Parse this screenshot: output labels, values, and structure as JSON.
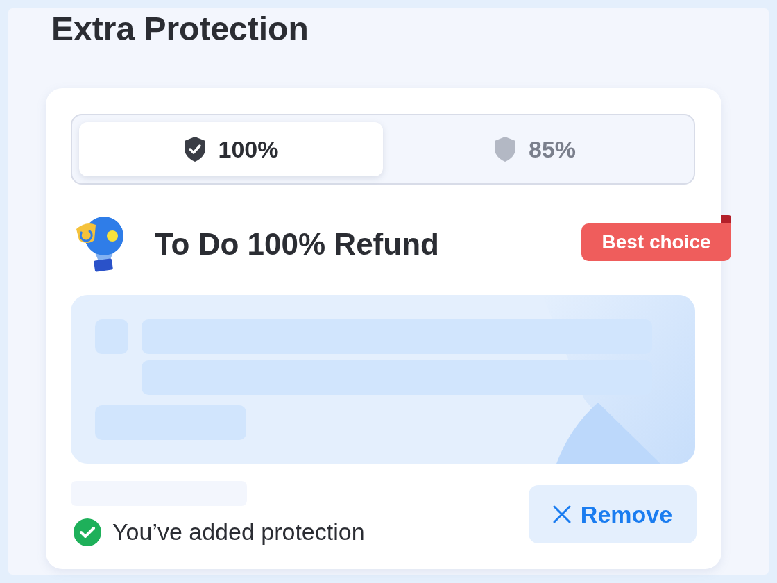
{
  "title": "Extra Protection",
  "tabs": [
    {
      "label": "100%",
      "selected": true
    },
    {
      "label": "85%",
      "selected": false
    }
  ],
  "plan": {
    "title": "To Do 100% Refund",
    "badge": "Best choice"
  },
  "status": {
    "text": "You’ve added protection",
    "added": true
  },
  "remove_button": {
    "label": "Remove"
  }
}
